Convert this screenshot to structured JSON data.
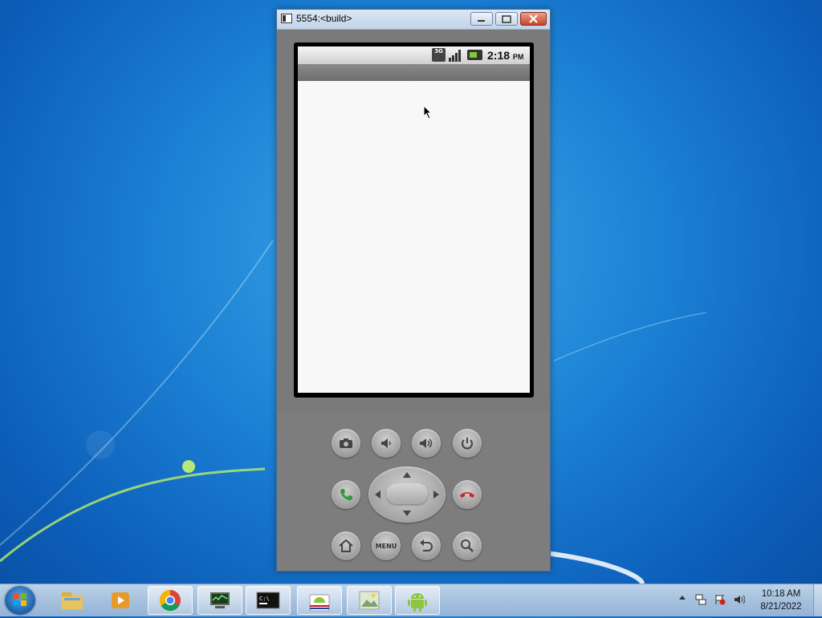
{
  "window": {
    "title": "5554:<build>",
    "min_label": "",
    "max_label": "",
    "close_label": ""
  },
  "phone": {
    "status_bar": {
      "network_label": "3G",
      "time": "2:18",
      "ampm": "PM"
    },
    "keypad": {
      "menu_label": "MENU"
    }
  },
  "taskbar": {
    "items": [
      {
        "icon": "windows-explorer-icon"
      },
      {
        "icon": "media-player-icon"
      },
      {
        "icon": "chrome-icon"
      },
      {
        "icon": "network-monitor-icon"
      },
      {
        "icon": "command-prompt-icon"
      },
      {
        "icon": "android-market-icon"
      },
      {
        "icon": "image-viewer-icon"
      },
      {
        "icon": "android-emulator-icon"
      }
    ],
    "clock": {
      "time": "10:18 AM",
      "date": "8/21/2022"
    }
  },
  "colors": {
    "desktop": "#1b7fd3",
    "emulator_body": "#7a7a7a",
    "screen_content": "#f8f8f8",
    "call_green": "#2e9a3a",
    "end_call_red": "#d32020"
  }
}
